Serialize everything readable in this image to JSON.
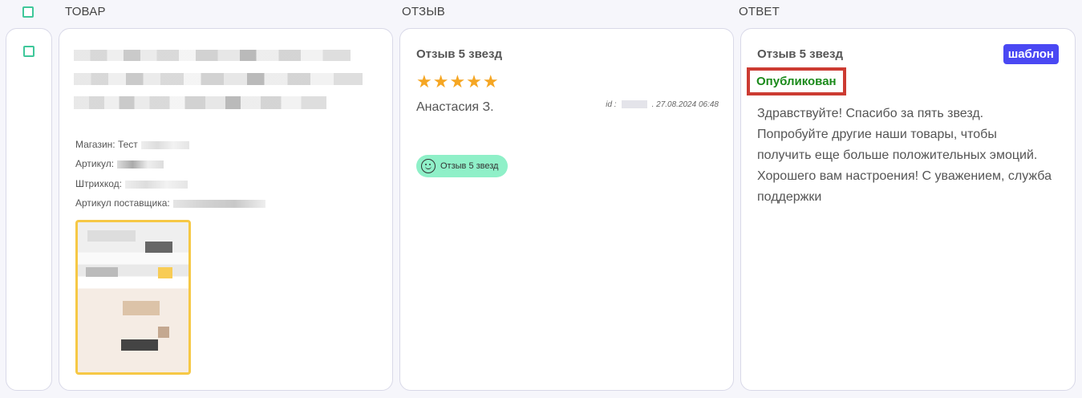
{
  "header": {
    "columns": [
      "ТОВАР",
      "ОТЗЫВ",
      "ОТВЕТ"
    ]
  },
  "product": {
    "shop_label": "Магазин: Тест",
    "article_label": "Артикул:",
    "barcode_label": "Штрихкод:",
    "supplier_article_label": "Артикул поставщика:"
  },
  "review": {
    "title": "Отзыв 5 звезд",
    "stars": "★★★★★",
    "rating": 5,
    "author": "Анастасия З.",
    "id_label": "id :",
    "date": ". 27.08.2024 06:48",
    "tag": "Отзыв 5 звезд"
  },
  "answer": {
    "title": "Отзыв 5 звезд",
    "template_badge": "шаблон",
    "status": "Опубликован",
    "text": "Здравствуйте! Спасибо за пять звезд. Попробуйте другие наши товары, чтобы получить еще больше положительных эмоций. Хорошего вам настроения! С уважением, служба поддержки"
  },
  "colors": {
    "accent": "#4a48f3",
    "status_green": "#1a8a1a",
    "highlight_red": "#cc3b32",
    "star": "#f5a623",
    "tag_bg": "#8ff0c8",
    "checkbox": "#3fc79a"
  }
}
